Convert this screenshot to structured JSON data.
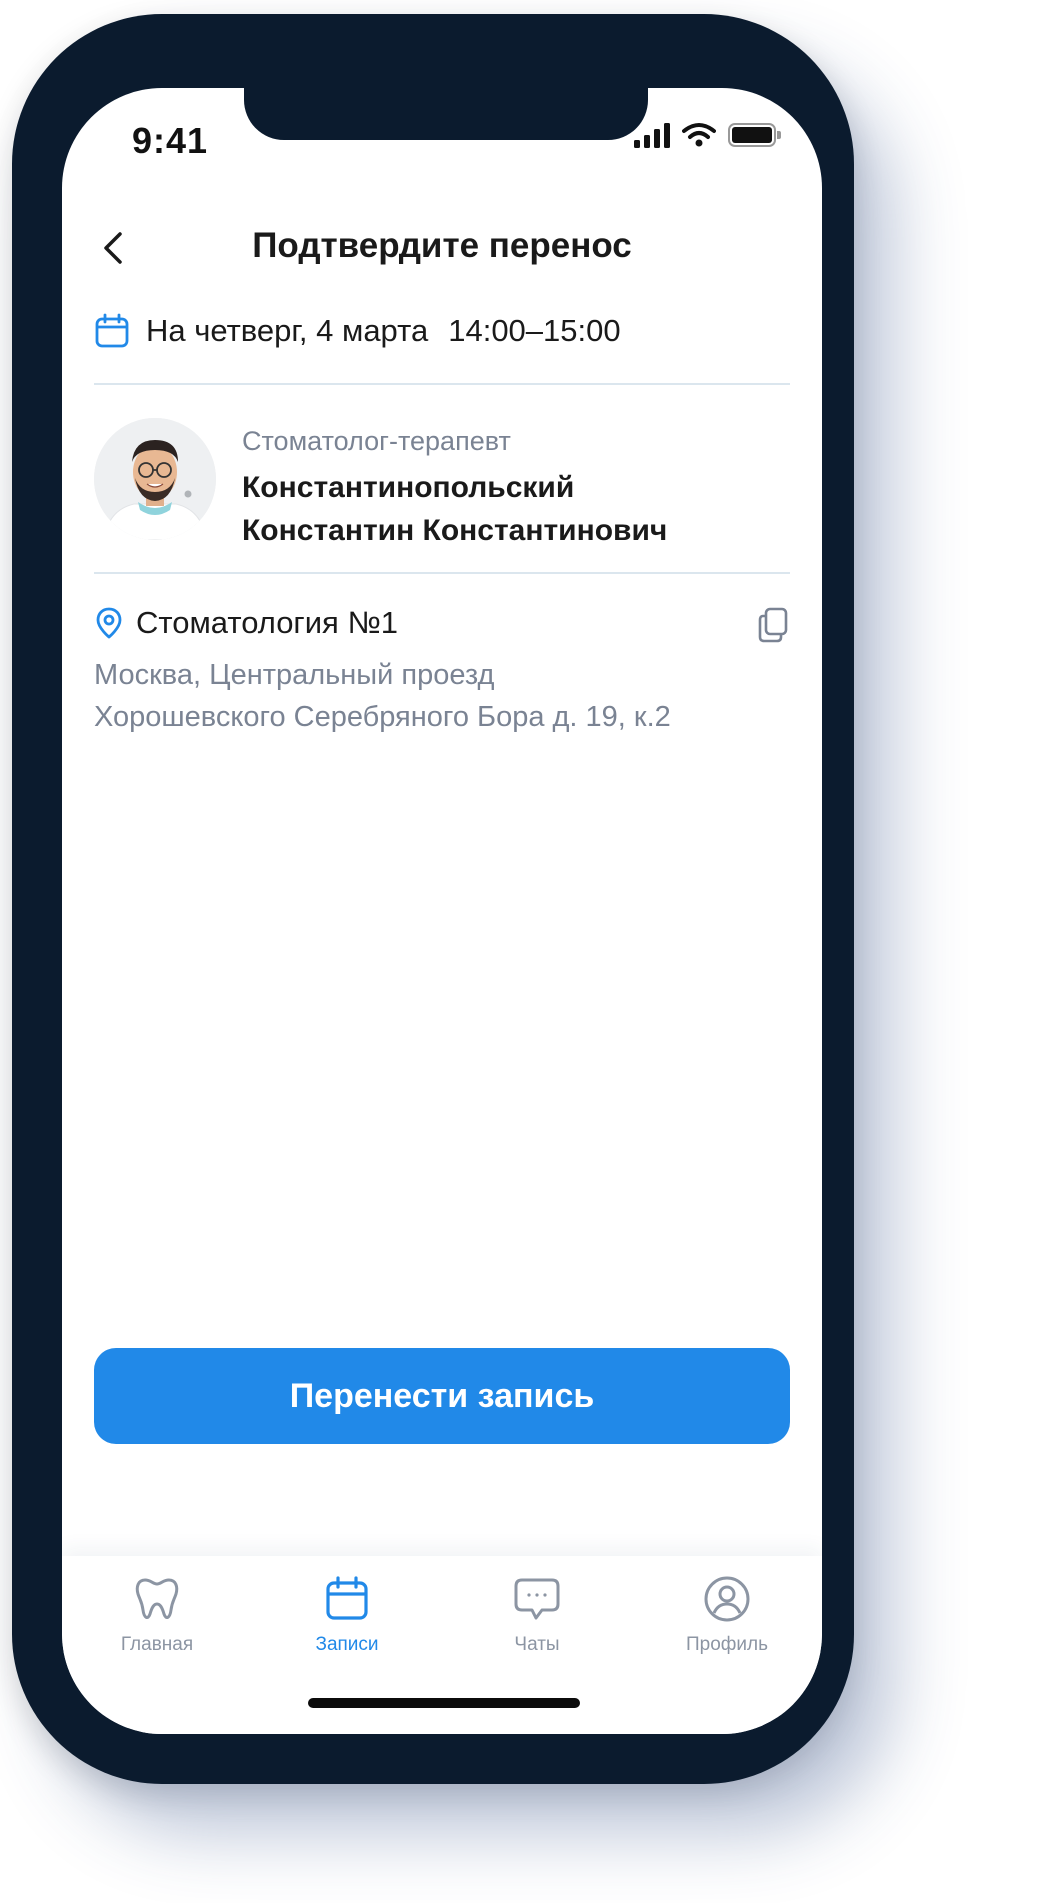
{
  "status_bar": {
    "time": "9:41"
  },
  "header": {
    "title": "Подтвердите перенос"
  },
  "appointment": {
    "date": "На четверг, 4 марта",
    "time": "14:00–15:00"
  },
  "doctor": {
    "specialty": "Стоматолог-терапевт",
    "name_line1": "Константинопольский",
    "name_line2": "Константин Константинович"
  },
  "clinic": {
    "name": "Стоматология №1",
    "address_line1": "Москва, Центральный проезд",
    "address_line2": "Хорошевского Серебряного Бора д. 19, к.2"
  },
  "action_button": {
    "label": "Перенести запись"
  },
  "tabs": [
    {
      "label": "Главная",
      "icon": "tooth-icon",
      "active": false
    },
    {
      "label": "Записи",
      "icon": "calendar-icon",
      "active": true
    },
    {
      "label": "Чаты",
      "icon": "chat-icon",
      "active": false
    },
    {
      "label": "Профиль",
      "icon": "profile-icon",
      "active": false
    }
  ],
  "colors": {
    "accent": "#2189e8",
    "frame": "#0b1b2e",
    "secondary_text": "#7a8393",
    "divider": "#dbe6ee"
  }
}
